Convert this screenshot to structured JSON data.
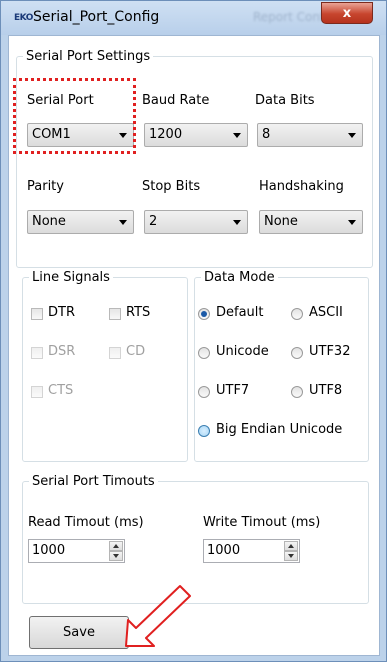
{
  "window": {
    "app_icon_text": "EKO",
    "title": "Serial_Port_Config",
    "ghost_text": "Report Config...",
    "close_symbol": "x"
  },
  "serial_settings": {
    "legend": "Serial Port Settings",
    "serial_port": {
      "label": "Serial Port",
      "value": "COM1"
    },
    "baud_rate": {
      "label": "Baud Rate",
      "value": "1200"
    },
    "data_bits": {
      "label": "Data Bits",
      "value": "8"
    },
    "parity": {
      "label": "Parity",
      "value": "None"
    },
    "stop_bits": {
      "label": "Stop Bits",
      "value": "2"
    },
    "handshaking": {
      "label": "Handshaking",
      "value": "None"
    }
  },
  "line_signals": {
    "legend": "Line Signals",
    "dtr": "DTR",
    "rts": "RTS",
    "dsr": "DSR",
    "cd": "CD",
    "cts": "CTS"
  },
  "data_mode": {
    "legend": "Data Mode",
    "default": "Default",
    "ascii": "ASCII",
    "unicode": "Unicode",
    "utf32": "UTF32",
    "utf7": "UTF7",
    "utf8": "UTF8",
    "big_endian": "Big Endian Unicode",
    "selected": "Default"
  },
  "timeouts": {
    "legend": "Serial Port Timouts",
    "read": {
      "label": "Read Timout (ms)",
      "value": "1000"
    },
    "write": {
      "label": "Write Timout (ms)",
      "value": "1000"
    }
  },
  "actions": {
    "save_label": "Save"
  },
  "colors": {
    "annotation": "#e02020",
    "accent": "#1c5aa7"
  }
}
